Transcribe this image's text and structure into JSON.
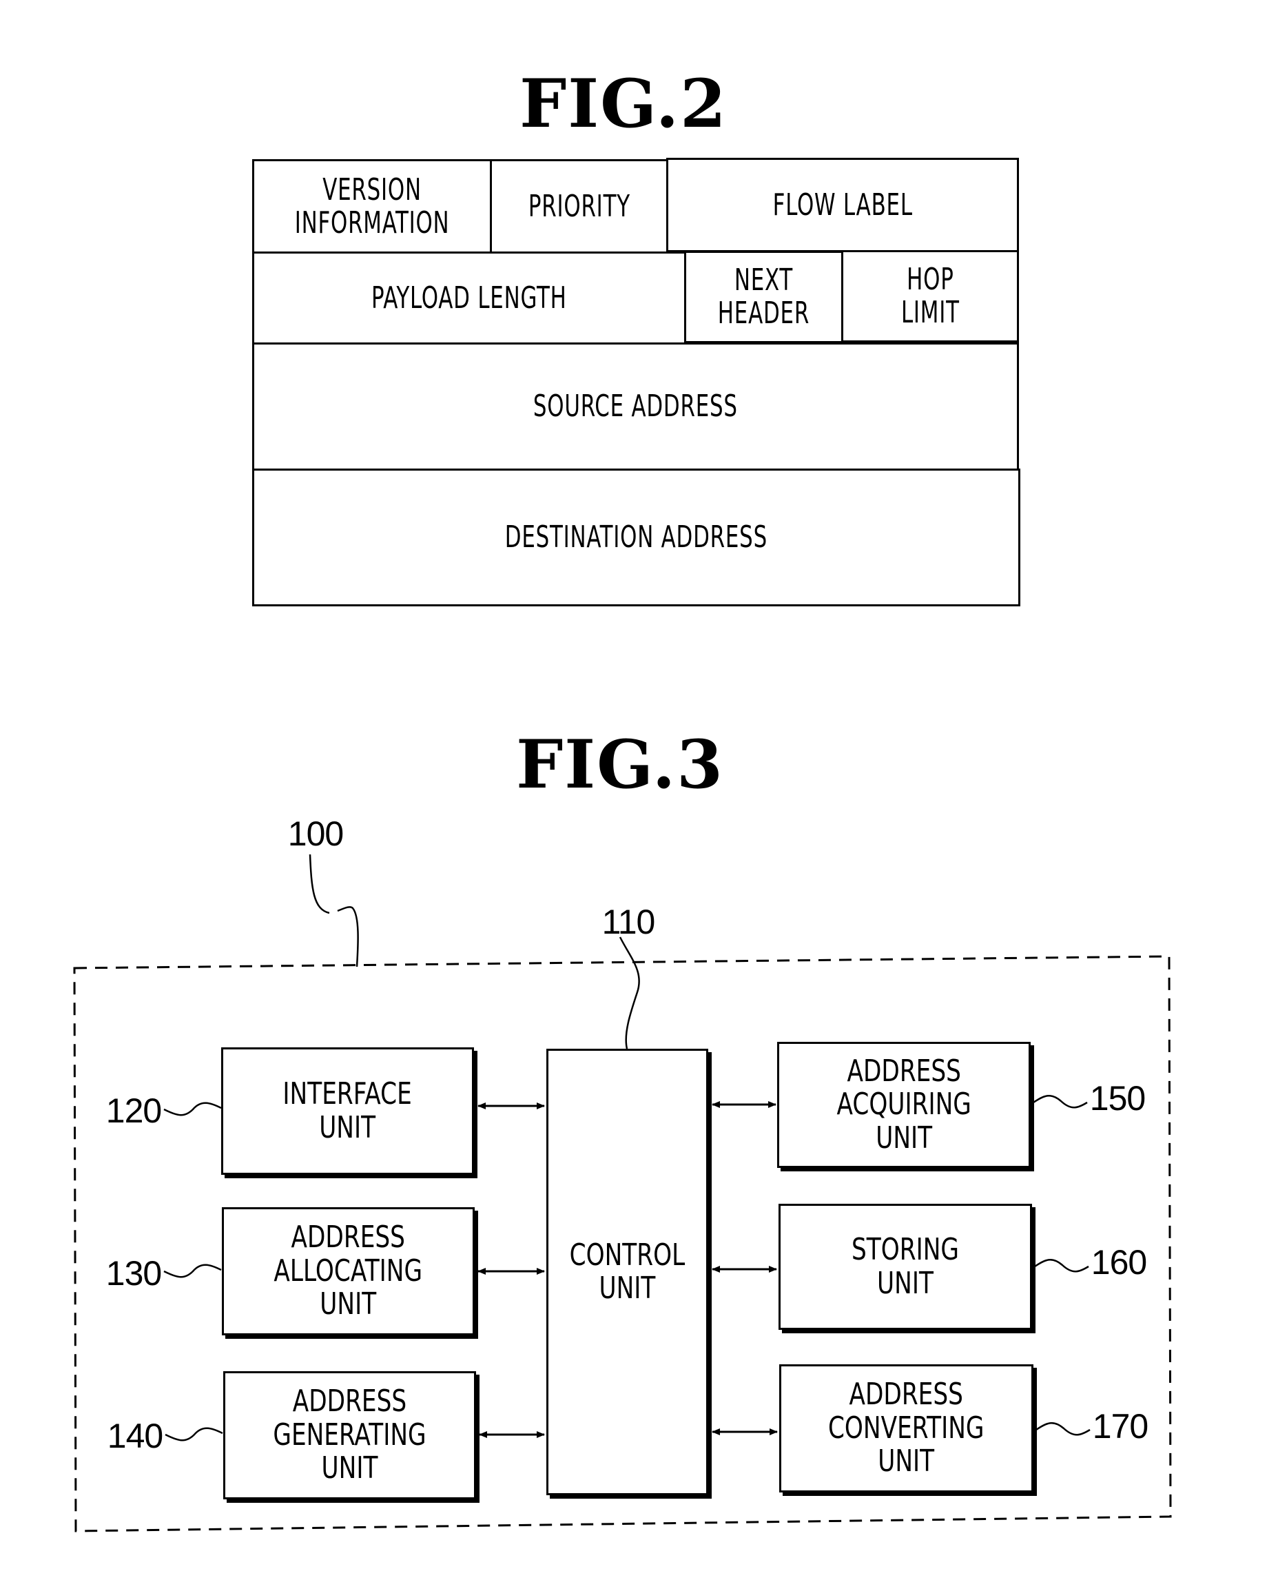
{
  "fig2": {
    "title": "FIG.2",
    "fields": {
      "version_information": "VERSION\nINFORMATION",
      "priority": "PRIORITY",
      "flow_label": "FLOW LABEL",
      "payload_length": "PAYLOAD LENGTH",
      "next_header": "NEXT\nHEADER",
      "hop_limit": "HOP\nLIMIT",
      "source_address": "SOURCE ADDRESS",
      "destination_address": "DESTINATION ADDRESS"
    }
  },
  "fig3": {
    "title": "FIG.3",
    "system_ref": "100",
    "control": {
      "ref": "110",
      "label": "CONTROL\nUNIT"
    },
    "left_units": [
      {
        "ref": "120",
        "label": "INTERFACE\nUNIT"
      },
      {
        "ref": "130",
        "label": "ADDRESS\nALLOCATING\nUNIT"
      },
      {
        "ref": "140",
        "label": "ADDRESS\nGENERATING\nUNIT"
      }
    ],
    "right_units": [
      {
        "ref": "150",
        "label": "ADDRESS\nACQUIRING\nUNIT"
      },
      {
        "ref": "160",
        "label": "STORING\nUNIT"
      },
      {
        "ref": "170",
        "label": "ADDRESS\nCONVERTING\nUNIT"
      }
    ]
  }
}
